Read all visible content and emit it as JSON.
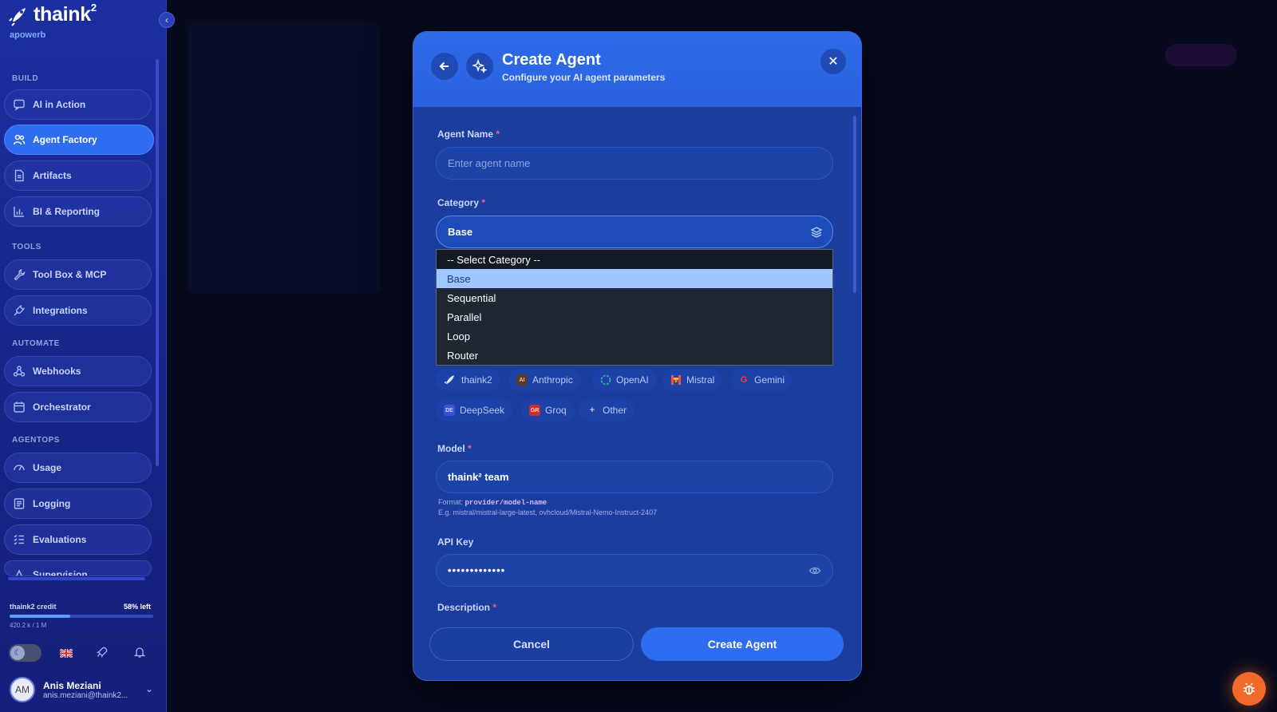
{
  "brand": {
    "name": "thaink",
    "superscript": "2",
    "workspace": "apowerb"
  },
  "sidebar": {
    "sections": [
      {
        "label": "BUILD"
      },
      {
        "label": "TOOLS"
      },
      {
        "label": "AUTOMATE"
      },
      {
        "label": "AGENTOPS"
      }
    ],
    "items": [
      {
        "label": "AI in Action",
        "icon": "chat-icon"
      },
      {
        "label": "Agent Factory",
        "icon": "users-icon",
        "active": true
      },
      {
        "label": "Artifacts",
        "icon": "file-icon"
      },
      {
        "label": "BI & Reporting",
        "icon": "bar-chart-icon"
      },
      {
        "label": "Tool Box & MCP",
        "icon": "wrench-icon"
      },
      {
        "label": "Integrations",
        "icon": "plug-icon"
      },
      {
        "label": "Webhooks",
        "icon": "webhook-icon"
      },
      {
        "label": "Orchestrator",
        "icon": "calendar-icon"
      },
      {
        "label": "Usage",
        "icon": "gauge-icon"
      },
      {
        "label": "Logging",
        "icon": "log-icon"
      },
      {
        "label": "Evaluations",
        "icon": "checklist-icon"
      },
      {
        "label": "Supervision",
        "icon": "supervision-icon"
      }
    ],
    "credit": {
      "label": "thaink2 credit",
      "left": "58% left",
      "used_fraction": 0.42,
      "usage": "420.2 k / 1 M"
    },
    "user": {
      "initials": "AM",
      "name": "Anis Meziani",
      "email": "anis.meziani@thaink2..."
    }
  },
  "modal": {
    "title": "Create Agent",
    "subtitle": "Configure your AI agent parameters",
    "fields": {
      "agent_name": {
        "label": "Agent Name",
        "required": "*",
        "placeholder": "Enter agent name"
      },
      "category": {
        "label": "Category",
        "required": "*",
        "value": "Base",
        "options": [
          "-- Select Category --",
          "Base",
          "Sequential",
          "Parallel",
          "Loop",
          "Router"
        ]
      },
      "providers": [
        {
          "label": "thaink2"
        },
        {
          "label": "Anthropic",
          "logo": "AI"
        },
        {
          "label": "OpenAI"
        },
        {
          "label": "Mistral"
        },
        {
          "label": "Gemini",
          "logo": "G"
        },
        {
          "label": "DeepSeek",
          "logo": "DE"
        },
        {
          "label": "Groq",
          "logo": "GR"
        },
        {
          "label": "Other",
          "logo": "+"
        }
      ],
      "model": {
        "label": "Model",
        "required": "*",
        "value": "thaink² team",
        "format_label": "Format:",
        "format_code": "provider/model-name",
        "example": "E.g. mistral/mistral-large-latest, ovhcloud/Mistral-Nemo-Instruct-2407"
      },
      "api_key": {
        "label": "API Key",
        "value": "•••••••••••••"
      },
      "description": {
        "label": "Description",
        "required": "*"
      }
    },
    "buttons": {
      "cancel": "Cancel",
      "create": "Create Agent"
    }
  },
  "colors": {
    "accent": "#2f6df0",
    "sidebar_bg": "#16268a",
    "modal_bg": "#1a3d9e",
    "required": "#ff5c7a",
    "bug_button": "#f26a2a"
  }
}
